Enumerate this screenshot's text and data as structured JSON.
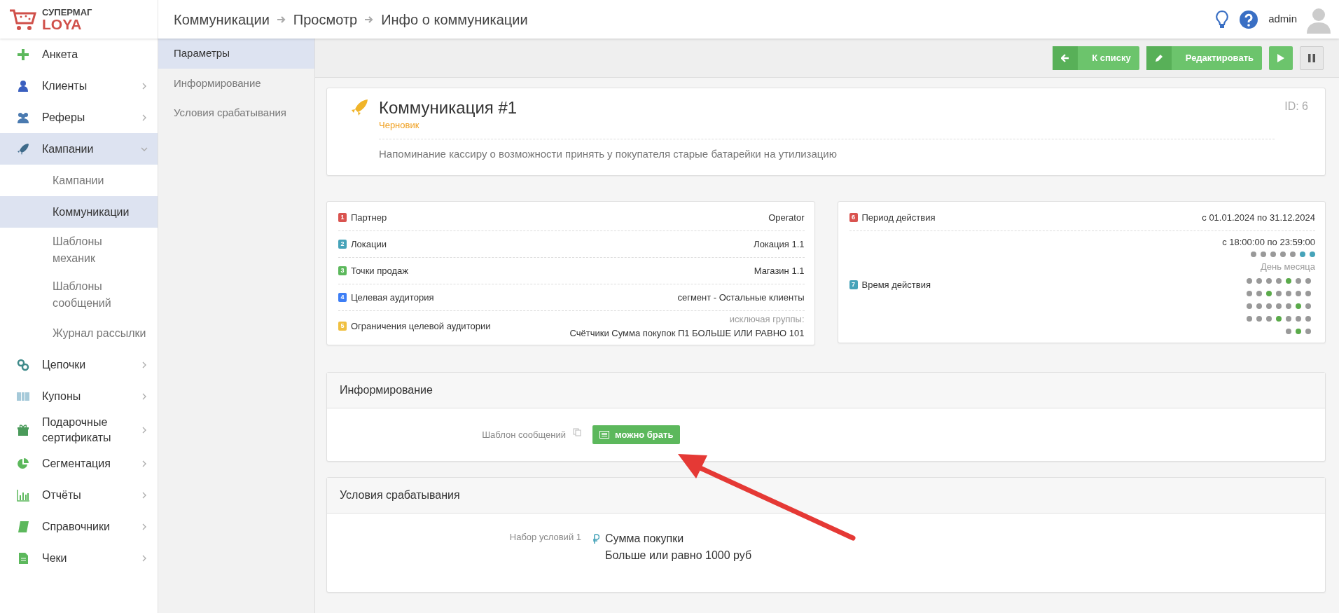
{
  "logo": {
    "line1": "СУПЕРМАГ",
    "line2": "LOYA"
  },
  "breadcrumbs": [
    "Коммуникации",
    "Просмотр",
    "Инфо о коммуникации"
  ],
  "user": {
    "name": "admin"
  },
  "sidebar": {
    "items": [
      {
        "label": "Анкета",
        "kind": "link",
        "selected": false
      },
      {
        "label": "Клиенты",
        "kind": "group",
        "expanded": false,
        "selected": false
      },
      {
        "label": "Реферы",
        "kind": "group",
        "expanded": false,
        "selected": false
      },
      {
        "label": "Кампании",
        "kind": "group",
        "expanded": true,
        "selected": true,
        "children": [
          {
            "label": "Кампании",
            "selected": false
          },
          {
            "label": "Коммуникации",
            "selected": true
          },
          {
            "label": "Шаблоны механик",
            "selected": false
          },
          {
            "label": "Шаблоны сообщений",
            "selected": false
          },
          {
            "label": "Журнал рассылки",
            "selected": false
          }
        ]
      },
      {
        "label": "Цепочки",
        "kind": "group",
        "expanded": false,
        "selected": false
      },
      {
        "label": "Купоны",
        "kind": "group",
        "expanded": false,
        "selected": false
      },
      {
        "label": "Подарочные сертификаты",
        "kind": "group",
        "expanded": false,
        "selected": false
      },
      {
        "label": "Сегментация",
        "kind": "group",
        "expanded": false,
        "selected": false
      },
      {
        "label": "Отчёты",
        "kind": "group",
        "expanded": false,
        "selected": false
      },
      {
        "label": "Справочники",
        "kind": "group",
        "expanded": false,
        "selected": false
      },
      {
        "label": "Чеки",
        "kind": "group",
        "expanded": false,
        "selected": false
      }
    ]
  },
  "subnav": [
    {
      "label": "Параметры",
      "selected": true
    },
    {
      "label": "Информирование",
      "selected": false
    },
    {
      "label": "Условия срабатывания",
      "selected": false
    }
  ],
  "toolbar": [
    {
      "kind": "icon-text",
      "label": "К списку"
    },
    {
      "kind": "icon-text",
      "label": "Редактировать"
    },
    {
      "kind": "play"
    },
    {
      "kind": "pause"
    }
  ],
  "header_card": {
    "title": "Коммуникация #1",
    "status": "Черновик",
    "id": "ID: 6",
    "description": "Напоминание кассиру о возможности принять у покупателя старые батарейки на утилизацию"
  },
  "params_left": [
    {
      "num": "1",
      "color": "#d9534f",
      "label": "Партнер",
      "value": "Operator"
    },
    {
      "num": "2",
      "color": "#46a3b9",
      "label": "Локации",
      "value": "Локация 1.1"
    },
    {
      "num": "3",
      "color": "#5cb85c",
      "label": "Точки продаж",
      "value": "Магазин 1.1"
    },
    {
      "num": "4",
      "color": "#3d7ef5",
      "label": "Целевая аудитория",
      "value": "сегмент - Остальные клиенты"
    },
    {
      "num": "5",
      "color": "#f0c040",
      "label": "Ограничения целевой аудитории",
      "note": "исключая группы:",
      "value": "Счётчики Сумма покупок П1 БОЛЬШЕ ИЛИ РАВНО 101"
    }
  ],
  "params_right": {
    "period": {
      "num": "6",
      "color": "#d9534f",
      "label": "Период действия",
      "value": "с 01.01.2024 по 31.12.2024"
    },
    "time": {
      "num": "7",
      "color": "#46a3b9",
      "label": "Время действия",
      "value": "с 18:00:00 по 23:59:00",
      "month_label": "День месяца",
      "week_days": [
        {
          "selected": false
        },
        {
          "selected": false
        },
        {
          "selected": false
        },
        {
          "selected": false
        },
        {
          "selected": false
        },
        {
          "selected": true
        },
        {
          "selected": true
        }
      ],
      "month_days": [
        {
          "selected": false
        },
        {
          "selected": false
        },
        {
          "selected": false
        },
        {
          "selected": false
        },
        {
          "selected": true
        },
        {
          "selected": false
        },
        {
          "selected": false
        },
        {
          "selected": false
        },
        {
          "selected": false
        },
        {
          "selected": true
        },
        {
          "selected": false
        },
        {
          "selected": false
        },
        {
          "selected": false
        },
        {
          "selected": false
        },
        {
          "selected": false
        },
        {
          "selected": false
        },
        {
          "selected": false
        },
        {
          "selected": false
        },
        {
          "selected": false
        },
        {
          "selected": true
        },
        {
          "selected": false
        },
        {
          "selected": false
        },
        {
          "selected": false
        },
        {
          "selected": false
        },
        {
          "selected": true
        },
        {
          "selected": false
        },
        {
          "selected": false
        },
        {
          "selected": false
        },
        {
          "selected": false
        },
        {
          "selected": true
        },
        {
          "selected": false
        }
      ]
    }
  },
  "informing": {
    "title": "Информирование",
    "label": "Шаблон сообщений",
    "button": "можно брать"
  },
  "conditions": {
    "title": "Условия срабатывания",
    "label": "Набор условий 1",
    "name": "Сумма покупки",
    "detail": "Больше или равно 1000 руб"
  }
}
